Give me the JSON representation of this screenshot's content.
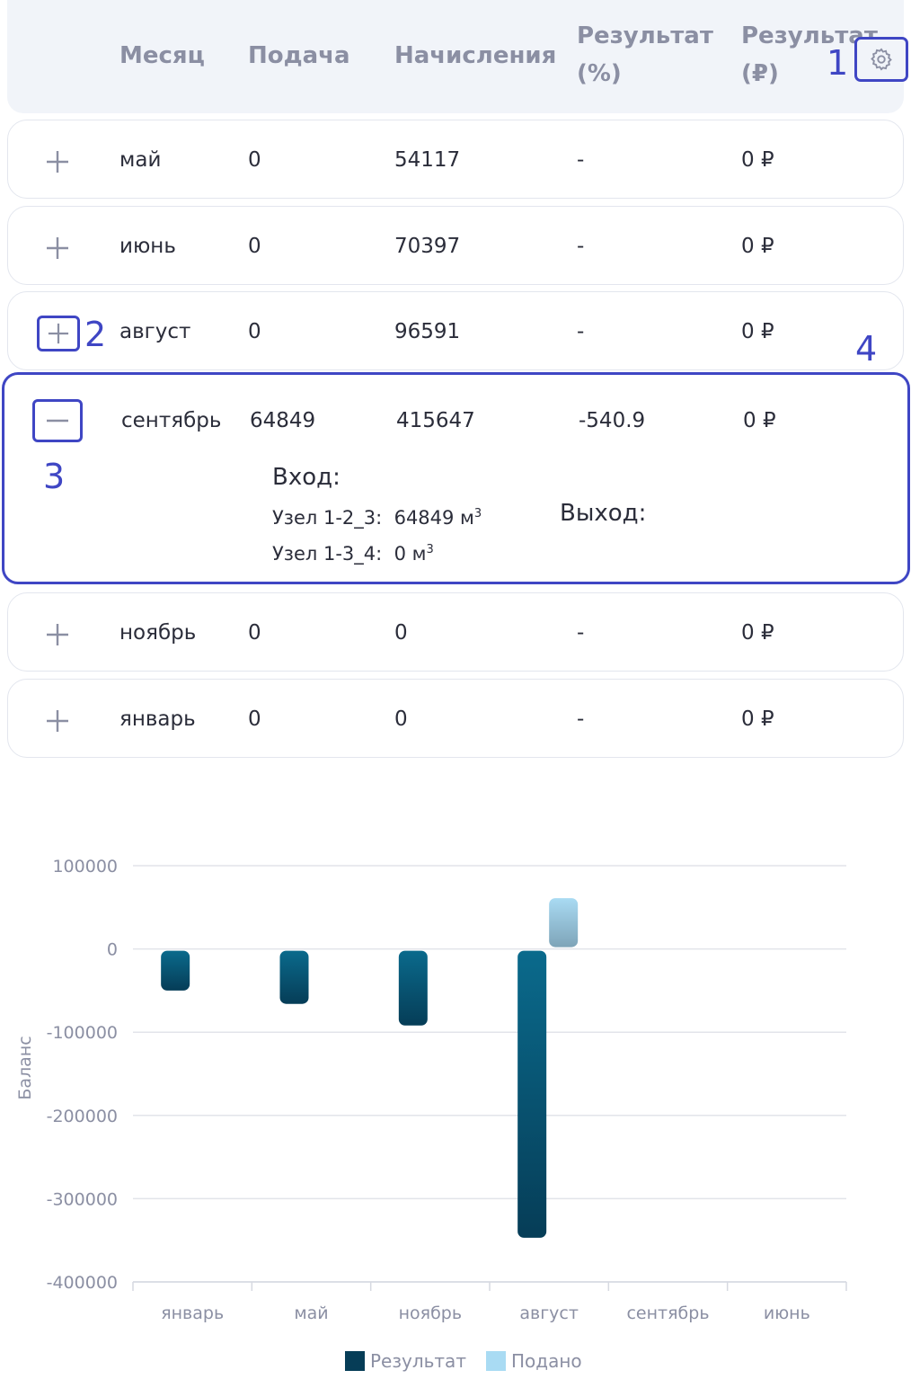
{
  "header": {
    "month": "Месяц",
    "supply": "Подача",
    "accruals": "Начисления",
    "result_pct_1": "Результат",
    "result_pct_2": "(%)",
    "result_rub_1": "Результат",
    "result_rub_2": "(₽)"
  },
  "annotations": [
    "1",
    "2",
    "3",
    "4"
  ],
  "rows": [
    {
      "month": "май",
      "supply": "0",
      "accruals": "54117",
      "result_pct": "-",
      "result_rub": "0 ₽"
    },
    {
      "month": "июнь",
      "supply": "0",
      "accruals": "70397",
      "result_pct": "-",
      "result_rub": "0 ₽"
    },
    {
      "month": "август",
      "supply": "0",
      "accruals": "96591",
      "result_pct": "-",
      "result_rub": "0 ₽"
    },
    {
      "month": "сентябрь",
      "supply": "64849",
      "accruals": "415647",
      "result_pct": "-540.9",
      "result_rub": "0 ₽"
    },
    {
      "month": "ноябрь",
      "supply": "0",
      "accruals": "0",
      "result_pct": "-",
      "result_rub": "0 ₽"
    },
    {
      "month": "январь",
      "supply": "0",
      "accruals": "0",
      "result_pct": "-",
      "result_rub": "0 ₽"
    }
  ],
  "details": {
    "input_title": "Вход:",
    "output_title": "Выход:",
    "inputs": [
      {
        "node": "Узел 1-2_3:",
        "value": "64849 м",
        "sup": "3"
      },
      {
        "node": "Узел 1-3_4:",
        "value": "0 м",
        "sup": "3"
      }
    ]
  },
  "icons": {
    "settings": "gear-icon",
    "expand": "plus-icon",
    "collapse": "minus-icon"
  },
  "colors": {
    "accent": "#3f46c4",
    "result_dark": "#063d57",
    "result_light": "#0a6a8c",
    "submitted": "#a9dbf3"
  },
  "chart_data": {
    "type": "bar",
    "ylabel": "Баланс",
    "ylim": [
      -400000,
      100000
    ],
    "yticks": [
      100000,
      0,
      -100000,
      -200000,
      -300000,
      -400000
    ],
    "categories": [
      "январь",
      "май",
      "ноябрь",
      "август",
      "сентябрь",
      "июнь"
    ],
    "series": [
      {
        "name": "Результат",
        "values": [
          -50000,
          -66000,
          -92000,
          -347000,
          0,
          0
        ]
      },
      {
        "name": "Подано",
        "values": [
          0,
          0,
          0,
          61000,
          0,
          0
        ]
      }
    ],
    "grid": true,
    "legend": "bottom"
  }
}
